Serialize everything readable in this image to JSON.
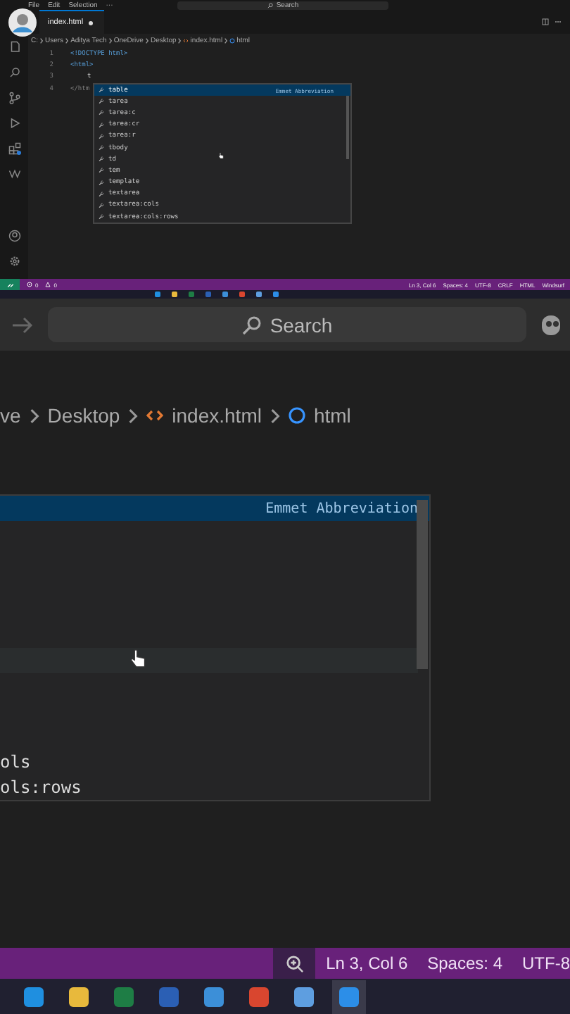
{
  "menu": [
    "File",
    "Edit",
    "Selection",
    "···"
  ],
  "command_center": {
    "placeholder": "Search"
  },
  "tab": {
    "label": "index.html",
    "modified": true
  },
  "breadcrumb": [
    "C:",
    "Users",
    "Aditya Tech",
    "OneDrive",
    "Desktop",
    "index.html",
    "html"
  ],
  "code_lines": [
    {
      "number": "1",
      "text": "<!DOCTYPE html>"
    },
    {
      "number": "2",
      "text": "<html>"
    },
    {
      "number": "3",
      "text": "t"
    },
    {
      "number": "4",
      "text": "</htm"
    }
  ],
  "suggestions": [
    {
      "label": "table",
      "selected": true
    },
    {
      "label": "tarea",
      "selected": false
    },
    {
      "label": "tarea:c",
      "selected": false
    },
    {
      "label": "tarea:cr",
      "selected": false
    },
    {
      "label": "tarea:r",
      "selected": false
    },
    {
      "label": "tbody",
      "selected": false
    },
    {
      "label": "td",
      "selected": false
    },
    {
      "label": "tem",
      "selected": false
    },
    {
      "label": "template",
      "selected": false
    },
    {
      "label": "textarea",
      "selected": false
    },
    {
      "label": "textarea:cols",
      "selected": false
    },
    {
      "label": "textarea:cols:rows",
      "selected": false
    }
  ],
  "suggestion_detail": "Emmet Abbreviation",
  "status_bar": {
    "problems": "0",
    "warnings": "0",
    "items": [
      "Ln 3, Col 6",
      "Spaces: 4",
      "UTF-8",
      "CRLF",
      "HTML",
      "Windsurf"
    ]
  },
  "zoomed": {
    "search": {
      "placeholder": "Search"
    },
    "breadcrumb": [
      "ve",
      "Desktop",
      "index.html",
      "html"
    ],
    "suggestion_detail": "Emmet Abbreviation",
    "suggestions": [
      {
        "label": "ols"
      },
      {
        "label": "ols:rows"
      }
    ],
    "status_items": [
      "Ln 3, Col 6",
      "Spaces: 4",
      "UTF-8"
    ]
  }
}
